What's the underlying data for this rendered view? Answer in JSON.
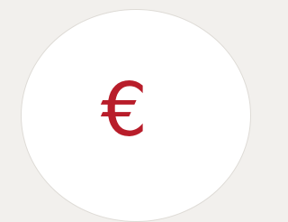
{
  "icon": {
    "name": "euro-icon",
    "glyph": "€",
    "color": "#b81d2a"
  },
  "colors": {
    "background": "#f2f0ed",
    "circle_fill": "#ffffff",
    "circle_border": "#dedbd6"
  }
}
